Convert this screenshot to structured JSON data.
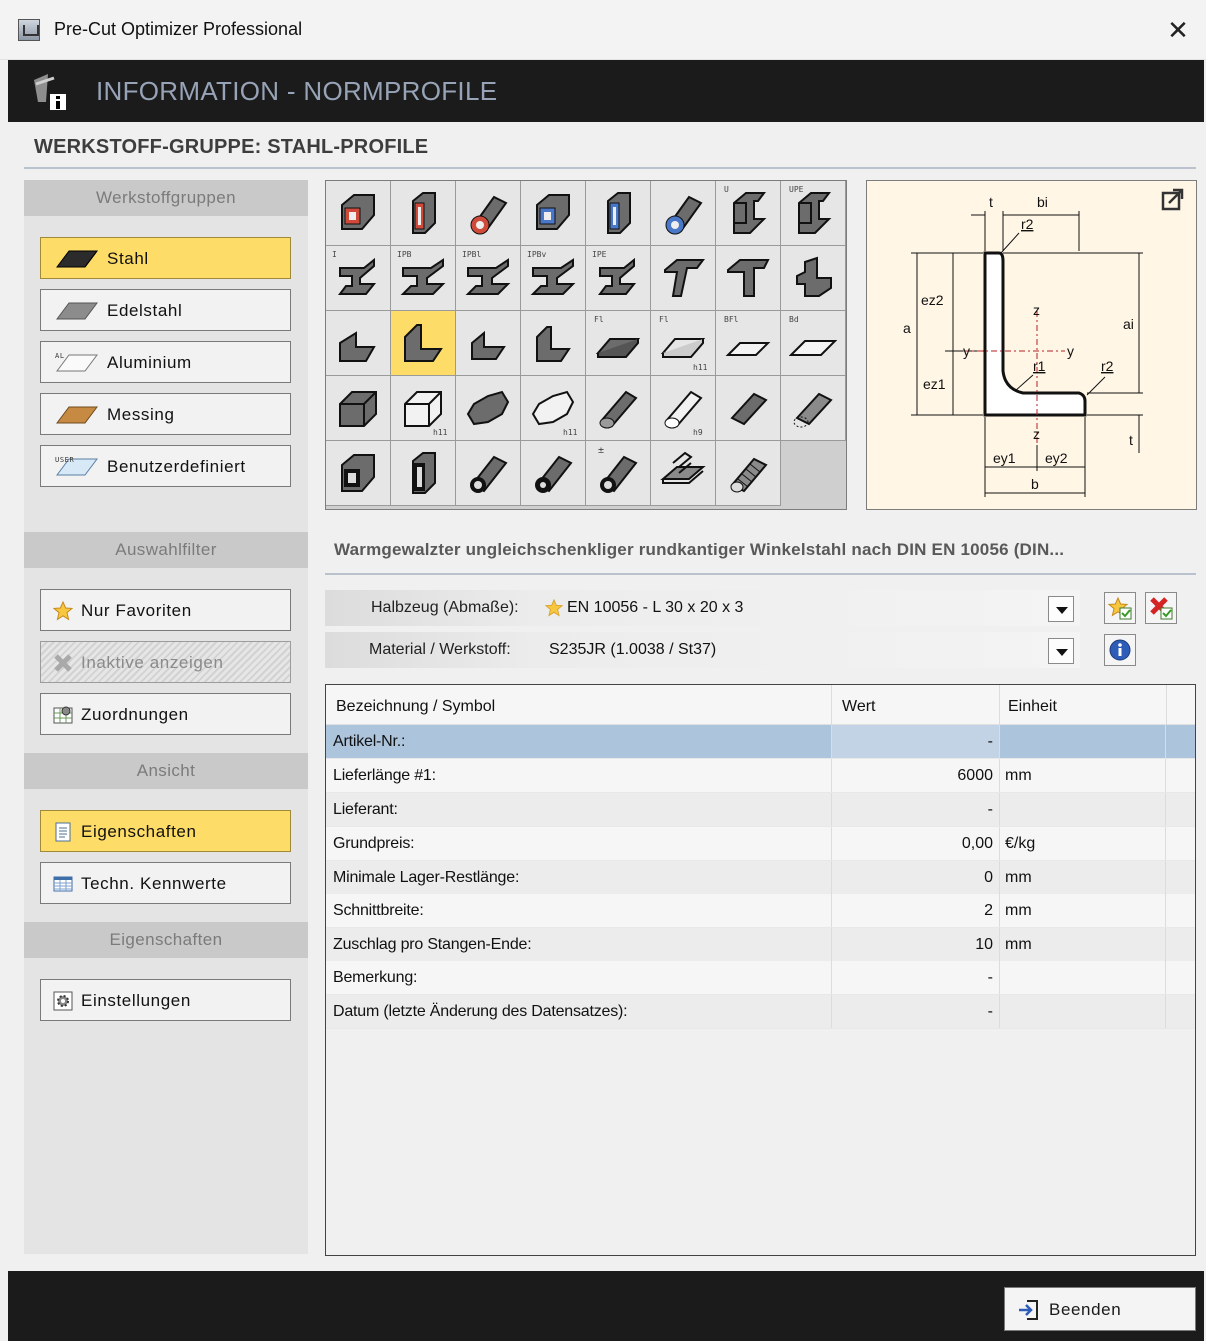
{
  "window": {
    "title": "Pre-Cut Optimizer Professional",
    "close_glyph": "✕"
  },
  "banner": {
    "title": "INFORMATION - NORMPROFILE"
  },
  "group_title": "WERKSTOFF-GRUPPE: STAHL-PROFILE",
  "left": {
    "werkstoffgruppen": "Werkstoffgruppen",
    "groups": [
      {
        "label": "Stahl",
        "icon": "steel-bar-icon",
        "color": "#2b2b2b",
        "selected": true
      },
      {
        "label": "Edelstahl",
        "icon": "stainless-bar-icon",
        "color": "#8c8c8c"
      },
      {
        "label": "Aluminium",
        "icon": "aluminium-bar-icon",
        "color": "#f4f4f4",
        "tag": "AL"
      },
      {
        "label": "Messing",
        "icon": "brass-bar-icon",
        "color": "#c78a43"
      },
      {
        "label": "Benutzerdefiniert",
        "icon": "user-bar-icon",
        "color": "#d7e8f7",
        "tag": "USER"
      }
    ],
    "auswahlfilter": "Auswahlfilter",
    "filters": {
      "favorites": "Nur Favoriten",
      "inactive": "Inaktive anzeigen",
      "assignments": "Zuordnungen"
    },
    "ansicht": "Ansicht",
    "views": {
      "properties": "Eigenschaften",
      "tech": "Techn. Kennwerte"
    },
    "eigenschaften": "Eigenschaften",
    "settings": "Einstellungen"
  },
  "profiles": {
    "tags": [
      "U",
      "UPE",
      "I",
      "IPB",
      "IPBl",
      "IPBv",
      "IPE",
      "Fl",
      "Fl",
      "h11",
      "BFl",
      "Bd",
      "h11",
      "h11",
      "h9",
      "±"
    ]
  },
  "diagram": {
    "labels": {
      "t": "t",
      "bi": "bi",
      "r2": "r2",
      "a": "a",
      "ai": "ai",
      "ez2": "ez2",
      "ez1": "ez1",
      "z": "z",
      "y": "y",
      "r1": "r1",
      "ey1": "ey1",
      "ey2": "ey2",
      "b": "b"
    }
  },
  "description": "Warmgewalzter ungleichschenkliger rundkantiger Winkelstahl nach DIN EN 10056 (DIN...",
  "fields": {
    "halbzeug_label": "Halbzeug (Abmaße):",
    "halbzeug_value": "EN 10056 - L 30 x 20 x 3",
    "material_label": "Material / Werkstoff:",
    "material_value": "S235JR  (1.0038 / St37)"
  },
  "table": {
    "headers": [
      "Bezeichnung / Symbol",
      "Wert",
      "Einheit"
    ],
    "rows": [
      {
        "name": "Artikel-Nr.:",
        "value": "-",
        "unit": ""
      },
      {
        "name": "Lieferlänge #1:",
        "value": "6000",
        "unit": "mm"
      },
      {
        "name": "Lieferant:",
        "value": "-",
        "unit": ""
      },
      {
        "name": "Grundpreis:",
        "value": "0,00",
        "unit": "€/kg"
      },
      {
        "name": "Minimale Lager-Restlänge:",
        "value": "0",
        "unit": "mm"
      },
      {
        "name": "Schnittbreite:",
        "value": "2",
        "unit": "mm"
      },
      {
        "name": "Zuschlag pro Stangen-Ende:",
        "value": "10",
        "unit": "mm"
      },
      {
        "name": "Bemerkung:",
        "value": "-",
        "unit": ""
      },
      {
        "name": "Datum (letzte Änderung des Datensatzes):",
        "value": "-",
        "unit": ""
      }
    ]
  },
  "footer": {
    "exit": "Beenden"
  },
  "colors": {
    "accent": "#fddc67",
    "banner": "#1b1b1b",
    "row_highlight": "#adc4dd"
  }
}
